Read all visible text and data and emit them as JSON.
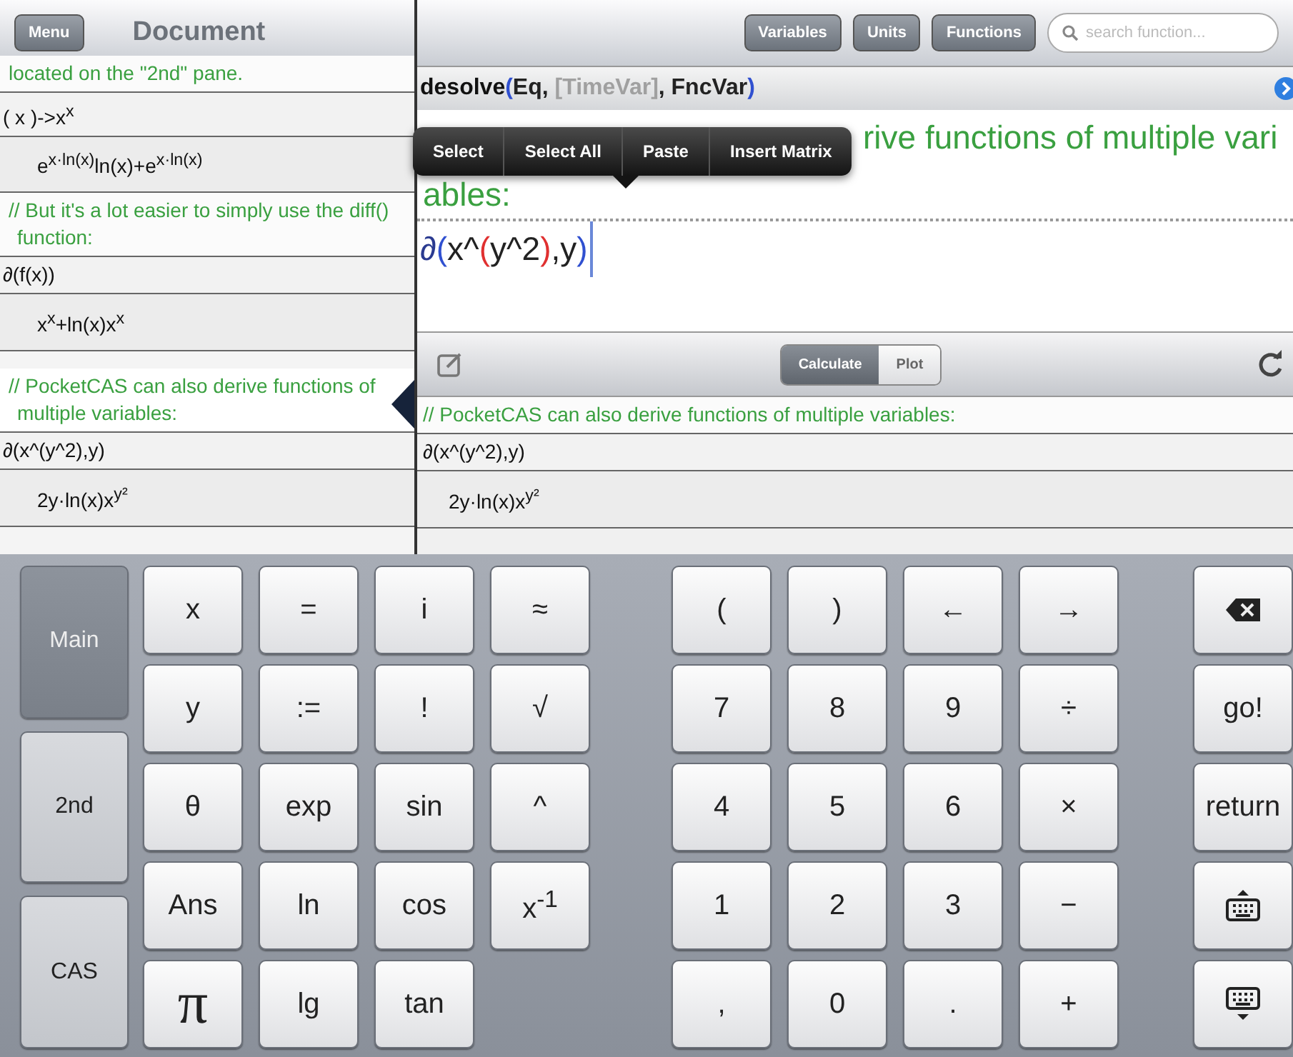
{
  "document": {
    "menu_button": "Menu",
    "title": "Document",
    "entries": [
      {
        "kind": "comment",
        "text": "located on the \"2nd\" pane.",
        "selected": false
      },
      {
        "kind": "input",
        "text": "( x )->x$^{x}$"
      },
      {
        "kind": "output",
        "text": "e$^{x·ln(x)}$ln(x)+e$^{x·ln(x)}$"
      },
      {
        "kind": "comment",
        "text": "// But it's a lot easier to simply use the diff() function:",
        "selected": false
      },
      {
        "kind": "input",
        "text": "∂(f(x))"
      },
      {
        "kind": "output",
        "text": "x$^{x}$+ln(x)x$^{x}$"
      },
      {
        "kind": "comment",
        "text": "// PocketCAS can also derive functions of multiple variables:",
        "selected": true
      },
      {
        "kind": "input",
        "text": "∂(x^(y^2),y)"
      },
      {
        "kind": "output",
        "text": "2y·ln(x)x$^{y²}$"
      }
    ]
  },
  "toolbar": {
    "buttons": [
      "Variables",
      "Units",
      "Functions"
    ],
    "search": {
      "placeholder": "search function..."
    }
  },
  "hint": [
    {
      "kind": "name",
      "text": "desolve"
    },
    {
      "kind": "paren",
      "text": "("
    },
    {
      "kind": "arg",
      "text": "Eq, "
    },
    {
      "kind": "optional",
      "text": "[TimeVar]"
    },
    {
      "kind": "arg",
      "text": ", FncVar"
    },
    {
      "kind": "paren",
      "text": ")"
    }
  ],
  "editor": {
    "comment_lines": [
      "rive functions of multiple vari",
      "ables:"
    ],
    "input": [
      {
        "kind": "operator",
        "text": "∂"
      },
      {
        "kind": "paren",
        "text": "("
      },
      {
        "kind": "arg",
        "text": "x^"
      },
      {
        "kind": "inner-paren",
        "text": "("
      },
      {
        "kind": "arg",
        "text": "y^2"
      },
      {
        "kind": "inner-paren",
        "text": ")"
      },
      {
        "kind": "arg",
        "text": ",y"
      },
      {
        "kind": "paren",
        "text": ")"
      }
    ],
    "context_menu": [
      "Select",
      "Select All",
      "Paste",
      "Insert Matrix"
    ]
  },
  "mode_tabs": [
    {
      "label": "Calculate",
      "selected": true
    },
    {
      "label": "Plot",
      "selected": false
    }
  ],
  "results": [
    {
      "kind": "comment",
      "text": "// PocketCAS can also derive functions of multiple variables:"
    },
    {
      "kind": "input",
      "text": "∂(x^(y^2),y)"
    },
    {
      "kind": "output",
      "text": "2y·ln(x)x$^{y²}$"
    }
  ],
  "keyboard": {
    "modes": [
      {
        "label": "Main",
        "selected": true
      },
      {
        "label": "2nd",
        "selected": false
      },
      {
        "label": "CAS",
        "selected": false
      }
    ],
    "function_keys": [
      [
        "x",
        "=",
        "i",
        "≈"
      ],
      [
        "y",
        ":=",
        "!",
        "√"
      ],
      [
        "θ",
        "exp",
        "sin",
        "^"
      ],
      [
        "Ans",
        "ln",
        "cos",
        "x$^{-1}$"
      ],
      [
        "π",
        "lg",
        "tan"
      ]
    ],
    "number_keys": [
      [
        "(",
        ")",
        "←",
        "→"
      ],
      [
        "7",
        "8",
        "9",
        "÷"
      ],
      [
        "4",
        "5",
        "6",
        "×"
      ],
      [
        "1",
        "2",
        "3",
        "−"
      ],
      [
        ",",
        "0",
        ".",
        "+"
      ]
    ],
    "action_keys": [
      {
        "kind": "backspace"
      },
      {
        "kind": "text",
        "label": "go!"
      },
      {
        "kind": "text",
        "label": "return"
      },
      {
        "kind": "keyboard-up"
      },
      {
        "kind": "keyboard-down"
      }
    ]
  }
}
